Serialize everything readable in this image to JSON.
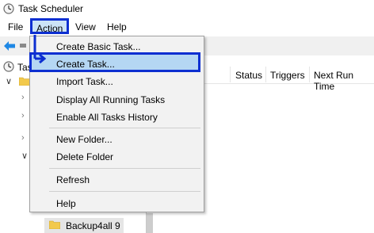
{
  "window": {
    "title": "Task Scheduler"
  },
  "menubar": {
    "file": "File",
    "action": "Action",
    "view": "View",
    "help": "Help"
  },
  "tree": {
    "root_label_partial": "Task",
    "selected_partial": "Backup4all 9"
  },
  "list": {
    "columns": [
      "Status",
      "Triggers",
      "Next Run Time"
    ]
  },
  "action_menu": {
    "items": [
      "Create Basic Task...",
      "Create Task...",
      "Import Task...",
      "Display All Running Tasks",
      "Enable All Tasks History",
      "New Folder...",
      "Delete Folder",
      "Refresh",
      "Help"
    ],
    "highlighted_index": 1
  },
  "colors": {
    "highlight_border": "#0d2fd1",
    "menu_hover": "#b5d7f3"
  },
  "icons": [
    "clock-icon",
    "back-arrow-icon",
    "folder-icon",
    "chevron-right-icon",
    "chevron-down-icon",
    "annotation-arrow-icon"
  ]
}
